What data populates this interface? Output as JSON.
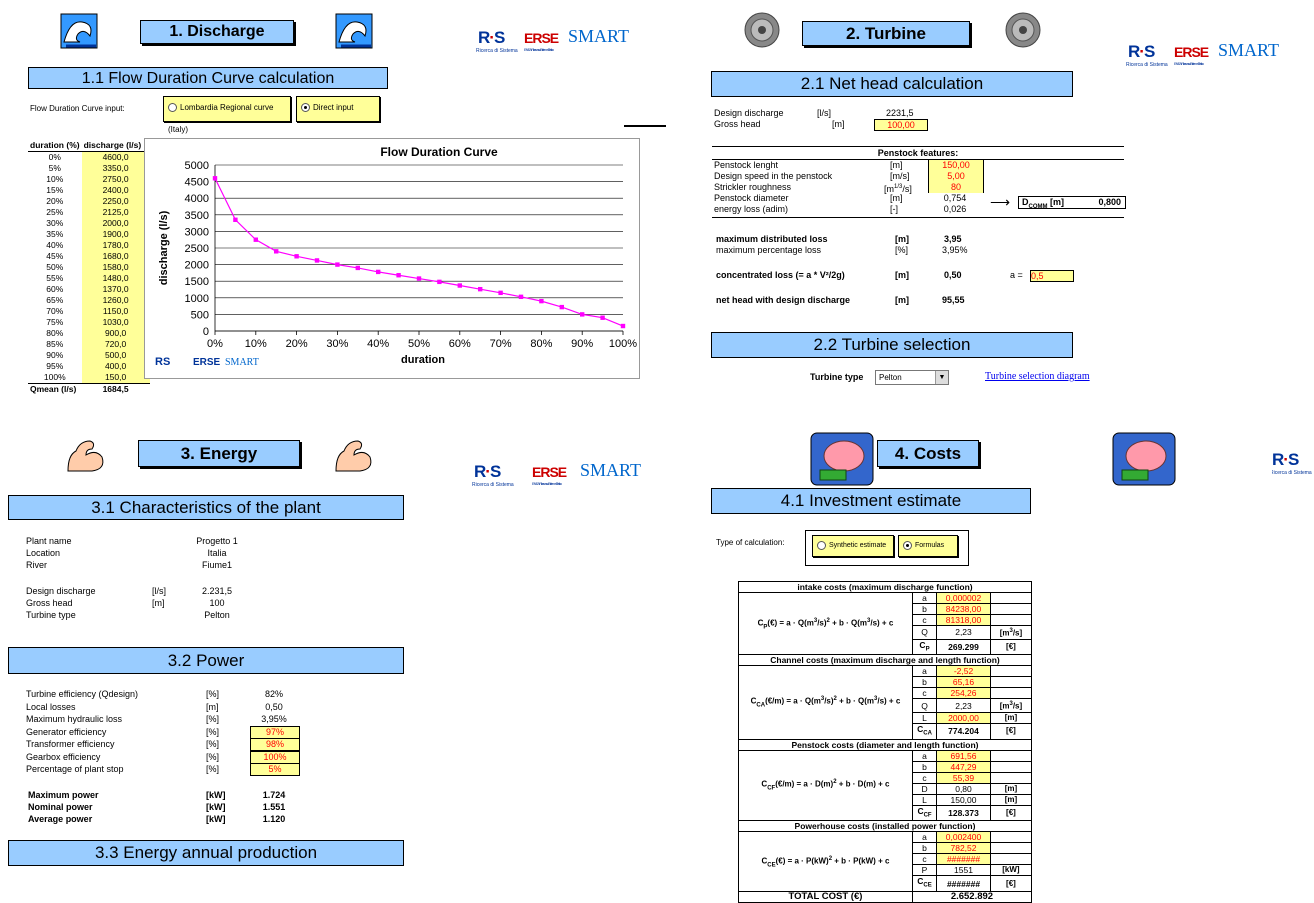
{
  "discharge": {
    "title": "1. Discharge",
    "fdc_title": "1.1 Flow Duration Curve calculation",
    "input_label": "Flow Duration Curve input:",
    "option_lombardia": "Lombardia Regional curve (Italy)",
    "option_direct": "Direct input",
    "table_headers": [
      "duration (%)",
      "discharge (l/s)"
    ],
    "rows": [
      [
        "0%",
        "4600,0"
      ],
      [
        "5%",
        "3350,0"
      ],
      [
        "10%",
        "2750,0"
      ],
      [
        "15%",
        "2400,0"
      ],
      [
        "20%",
        "2250,0"
      ],
      [
        "25%",
        "2125,0"
      ],
      [
        "30%",
        "2000,0"
      ],
      [
        "35%",
        "1900,0"
      ],
      [
        "40%",
        "1780,0"
      ],
      [
        "45%",
        "1680,0"
      ],
      [
        "50%",
        "1580,0"
      ],
      [
        "55%",
        "1480,0"
      ],
      [
        "60%",
        "1370,0"
      ],
      [
        "65%",
        "1260,0"
      ],
      [
        "70%",
        "1150,0"
      ],
      [
        "75%",
        "1030,0"
      ],
      [
        "80%",
        "900,0"
      ],
      [
        "85%",
        "720,0"
      ],
      [
        "90%",
        "500,0"
      ],
      [
        "95%",
        "400,0"
      ],
      [
        "100%",
        "150,0"
      ]
    ],
    "qmean_label": "Qmean (l/s)",
    "qmean_value": "1684,5"
  },
  "chart_data": {
    "type": "line",
    "title": "Flow Duration Curve",
    "xlabel": "duration",
    "ylabel": "discharge (l/s)",
    "x": [
      0,
      5,
      10,
      15,
      20,
      25,
      30,
      35,
      40,
      45,
      50,
      55,
      60,
      65,
      70,
      75,
      80,
      85,
      90,
      95,
      100
    ],
    "values": [
      4600,
      3350,
      2750,
      2400,
      2250,
      2125,
      2000,
      1900,
      1780,
      1680,
      1580,
      1480,
      1370,
      1260,
      1150,
      1030,
      900,
      720,
      500,
      400,
      150
    ],
    "xlim": [
      0,
      100
    ],
    "ylim": [
      0,
      5000
    ],
    "xticks": [
      "0%",
      "10%",
      "20%",
      "30%",
      "40%",
      "50%",
      "60%",
      "70%",
      "80%",
      "90%",
      "100%"
    ],
    "yticks": [
      "0",
      "500",
      "1000",
      "1500",
      "2000",
      "2500",
      "3000",
      "3500",
      "4000",
      "4500",
      "5000"
    ],
    "grid": true,
    "color": "#FF00FF"
  },
  "logos": {
    "rs": "RS",
    "rs_sub": "Ricerca di Sistema",
    "erse": "ERSE",
    "erse_sub": "ENEA-Ricerca sul Sistema Elettrico",
    "smart": "SMART"
  },
  "turbine": {
    "title": "2. Turbine",
    "net_head_title": "2.1 Net head calculation",
    "design_discharge": {
      "label": "Design discharge",
      "unit": "[l/s]",
      "value": "2231,5"
    },
    "gross_head": {
      "label": "Gross head",
      "unit": "[m]",
      "value": "100,00"
    },
    "penstock_header": "Penstock features:",
    "penstock_rows": [
      {
        "label": "Penstock lenght",
        "unit": "[m]",
        "value": "150,00",
        "input": true
      },
      {
        "label": "Design speed in the penstock",
        "unit": "[m/s]",
        "value": "5,00",
        "input": true
      },
      {
        "label": "Strickler roughness",
        "unit": "[m1/3/s]",
        "value": "80",
        "input": true
      },
      {
        "label": "Penstock diameter",
        "unit": "[m]",
        "value": "0,754",
        "input": false
      },
      {
        "label": "energy loss (adim)",
        "unit": "[-]",
        "value": "0,026",
        "input": false
      }
    ],
    "arrow": "⟶",
    "dcomm_label": "DCOMM [m]",
    "dcomm_value": "0,800",
    "max_dist_loss": {
      "label": "maximum distributed loss",
      "unit": "[m]",
      "value": "3,95"
    },
    "max_pct_loss": {
      "label": "maximum percentage loss",
      "unit": "[%]",
      "value": "3,95%"
    },
    "conc_loss": {
      "label": "concentrated loss (= a * V²/2g)",
      "unit": "[m]",
      "value": "0,50"
    },
    "a_label": "a =",
    "a_value": "0,5",
    "net_head": {
      "label": "net head with design discharge",
      "unit": "[m]",
      "value": "95,55"
    },
    "selection_title": "2.2 Turbine selection",
    "type_label": "Turbine type",
    "type_value": "Pelton",
    "diagram_link": "Turbine selection diagram"
  },
  "energy": {
    "title": "3. Energy",
    "char_title": "3.1 Characteristics of the plant",
    "plant": [
      {
        "label": "Plant name",
        "unit": "",
        "value": "Progetto 1"
      },
      {
        "label": "Location",
        "unit": "",
        "value": "Italia"
      },
      {
        "label": "River",
        "unit": "",
        "value": "Fiume1"
      }
    ],
    "plant2": [
      {
        "label": "Design discharge",
        "unit": "[l/s]",
        "value": "2.231,5"
      },
      {
        "label": "Gross head",
        "unit": "[m]",
        "value": "100"
      },
      {
        "label": "Turbine type",
        "unit": "",
        "value": "Pelton"
      }
    ],
    "power_title": "3.2 Power",
    "power": [
      {
        "label": "Turbine efficiency (Qdesign)",
        "unit": "[%]",
        "value": "82%",
        "input": false
      },
      {
        "label": "Local losses",
        "unit": "[m]",
        "value": "0,50",
        "input": false
      },
      {
        "label": "Maximum hydraulic loss",
        "unit": "[%]",
        "value": "3,95%",
        "input": false
      },
      {
        "label": "Generator efficiency",
        "unit": "[%]",
        "value": "97%",
        "input": true
      },
      {
        "label": "Transformer efficiency",
        "unit": "[%]",
        "value": "98%",
        "input": true
      },
      {
        "label": "Gearbox efficiency",
        "unit": "[%]",
        "value": "100%",
        "input": true
      },
      {
        "label": "Percentage of plant stop",
        "unit": "[%]",
        "value": "5%",
        "input": true
      }
    ],
    "power_out": [
      {
        "label": "Maximum power",
        "unit": "[kW]",
        "value": "1.724"
      },
      {
        "label": "Nominal power",
        "unit": "[kW]",
        "value": "1.551"
      },
      {
        "label": "Average power",
        "unit": "[kW]",
        "value": "1.120"
      }
    ],
    "annual_title": "3.3 Energy annual production"
  },
  "costs": {
    "title": "4. Costs",
    "invest_title": "4.1 Investment estimate",
    "calc_label": "Type of calculation:",
    "option_synthetic": "Synthetic estimate",
    "option_formulas": "Formulas",
    "intake": {
      "header": "intake costs (maximum discharge function)",
      "formula": "CP(€) = a · Q(m³/s)² + b · Q(m³/s) + c",
      "rows": [
        [
          "a",
          "0,000002",
          "",
          true
        ],
        [
          "b",
          "84238,00",
          "",
          true
        ],
        [
          "c",
          "81318,00",
          "",
          true
        ],
        [
          "Q",
          "2,23",
          "[m³/s]",
          false
        ],
        [
          "CP",
          "269.299",
          "[€]",
          false
        ]
      ]
    },
    "channel": {
      "header": "Channel costs (maximum discharge and length function)",
      "formula": "CCA(€/m) = a · Q(m³/s)² + b · Q(m³/s) + c",
      "rows": [
        [
          "a",
          "-2,52",
          "",
          true
        ],
        [
          "b",
          "65,16",
          "",
          true
        ],
        [
          "c",
          "254,26",
          "",
          true
        ],
        [
          "Q",
          "2,23",
          "[m³/s]",
          false
        ],
        [
          "L",
          "2000,00",
          "[m]",
          true
        ],
        [
          "CCA",
          "774.204",
          "[€]",
          false
        ]
      ]
    },
    "penstock": {
      "header": "Penstock costs (diameter and length function)",
      "formula": "CCF(€/m) = a · D(m)² + b · D(m) + c",
      "rows": [
        [
          "a",
          "691,56",
          "",
          true
        ],
        [
          "b",
          "447,29",
          "",
          true
        ],
        [
          "c",
          "55,39",
          "",
          true
        ],
        [
          "D",
          "0,80",
          "[m]",
          false
        ],
        [
          "L",
          "150,00",
          "[m]",
          false
        ],
        [
          "CCF",
          "128.373",
          "[€]",
          false
        ]
      ]
    },
    "powerhouse": {
      "header": "Powerhouse costs (installed power function)",
      "formula": "CCE(€) = a · P(kW)² + b · P(kW) + c",
      "rows": [
        [
          "a",
          "0,002400",
          "",
          true
        ],
        [
          "b",
          "782,52",
          "",
          true
        ],
        [
          "c",
          "#######",
          "",
          true
        ],
        [
          "P",
          "1551",
          "[kW]",
          false
        ],
        [
          "CCE",
          "#######",
          "[€]",
          false
        ]
      ]
    },
    "total_label": "TOTAL COST (€)",
    "total_value": "2.652.892"
  }
}
